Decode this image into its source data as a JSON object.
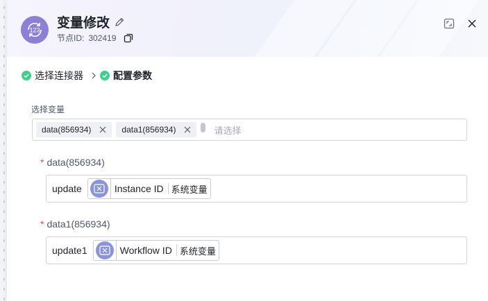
{
  "header": {
    "title": "变量修改",
    "node_id_label": "节点ID:",
    "node_id_value": "302419",
    "node_icon_text": "123",
    "accent_color": "#8b7fd6"
  },
  "steps": [
    {
      "label": "选择连接器",
      "status": "done"
    },
    {
      "label": "配置参数",
      "status": "done-active"
    }
  ],
  "select_variables": {
    "label": "选择变量",
    "tags": [
      "data(856934)",
      "data1(856934)"
    ],
    "placeholder": "请选择"
  },
  "variables": [
    {
      "label": "data(856934)",
      "required": "*",
      "prefix": "update",
      "chip_name": "Instance ID",
      "chip_type": "系统变量"
    },
    {
      "label": "data1(856934)",
      "required": "*",
      "prefix": "update1",
      "chip_name": "Workflow ID",
      "chip_type": "系统变量"
    }
  ],
  "icons": {
    "edit": "pencil-icon",
    "copy": "copy-icon",
    "fullscreen": "fullscreen-icon",
    "close": "close-icon",
    "step_check": "check-circle-icon",
    "variable": "variable-icon"
  }
}
